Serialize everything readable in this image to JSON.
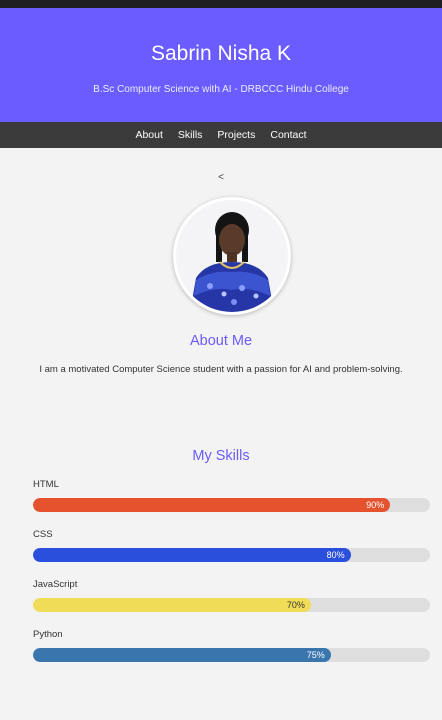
{
  "header": {
    "title": "Sabrin Nisha K",
    "subtitle": "B.Sc Computer Science with AI - DRBCCC Hindu College"
  },
  "nav": {
    "items": [
      "About",
      "Skills",
      "Projects",
      "Contact"
    ]
  },
  "carousel": {
    "prev_glyph": "<"
  },
  "about": {
    "heading": "About Me",
    "text": "I am a motivated Computer Science student with a passion for AI and problem-solving."
  },
  "skills": {
    "heading": "My Skills",
    "items": [
      {
        "name": "HTML",
        "percent_label": "90%",
        "level": 0.9,
        "color": "#e4532e",
        "label_color": "#ffffff"
      },
      {
        "name": "CSS",
        "percent_label": "80%",
        "level": 0.8,
        "color": "#2a4fdc",
        "label_color": "#ffffff"
      },
      {
        "name": "JavaScript",
        "percent_label": "70%",
        "level": 0.7,
        "color": "#f0dc56",
        "label_color": "#333333"
      },
      {
        "name": "Python",
        "percent_label": "75%",
        "level": 0.75,
        "color": "#3a76ad",
        "label_color": "#ffffff"
      }
    ]
  },
  "colors": {
    "header_bg": "#6a5cff",
    "nav_bg": "#3b3b3b",
    "accent": "#6a5cff",
    "page_bg": "#f3f3f3"
  }
}
